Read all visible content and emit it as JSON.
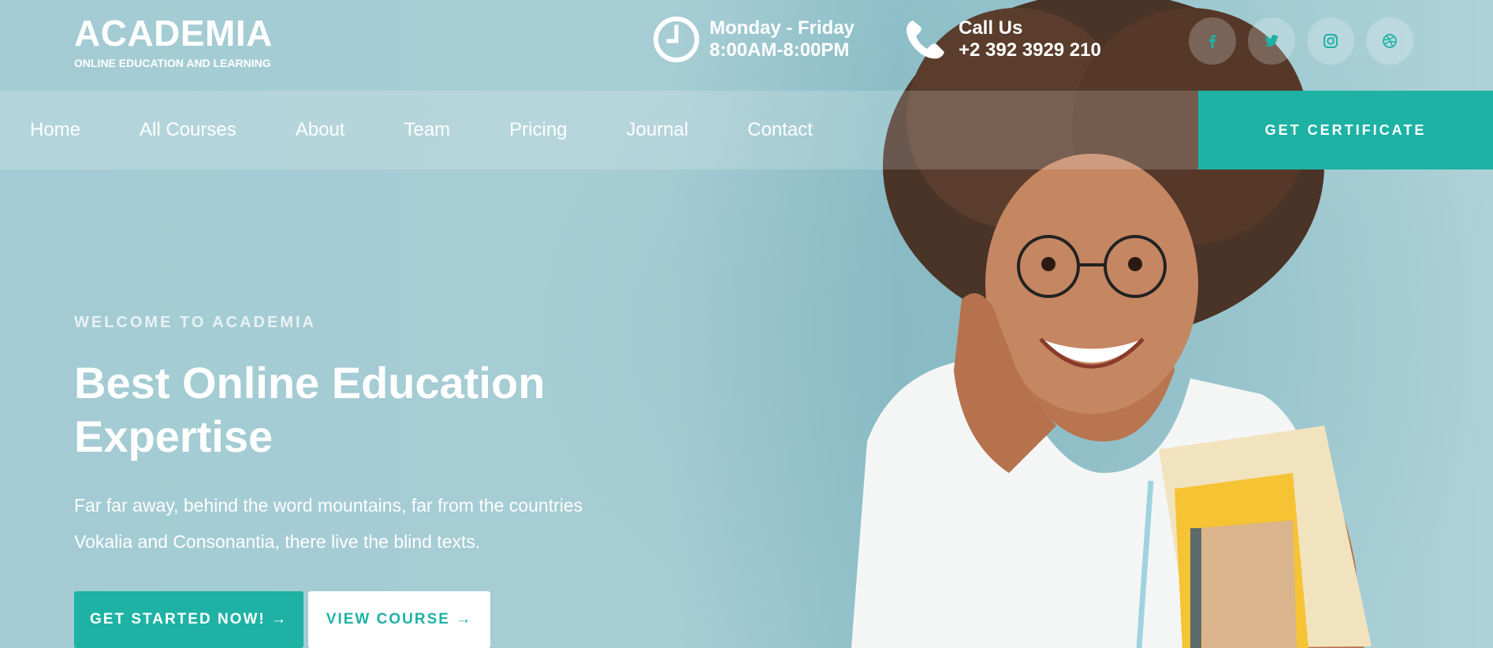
{
  "brand": {
    "name": "ACADEMIA",
    "tagline": "ONLINE EDUCATION AND LEARNING"
  },
  "contact": {
    "hours_title": "Monday - Friday",
    "hours_value": "8:00AM-8:00PM",
    "call_title": "Call Us",
    "call_value": "+2 392 3929 210"
  },
  "socials": [
    {
      "icon": "facebook-icon"
    },
    {
      "icon": "twitter-icon"
    },
    {
      "icon": "instagram-icon"
    },
    {
      "icon": "dribbble-icon"
    }
  ],
  "nav": {
    "items": [
      "Home",
      "All Courses",
      "About",
      "Team",
      "Pricing",
      "Journal",
      "Contact"
    ],
    "cta": "GET CERTIFICATE"
  },
  "hero": {
    "eyebrow": "WELCOME TO ACADEMIA",
    "headline_line1": "Best Online Education",
    "headline_line2": "Expertise",
    "lead_line1": "Far far away, behind the word mountains, far from the countries",
    "lead_line2": "Vokalia and Consonantia, there live the blind texts.",
    "primary_button": "GET STARTED NOW! →",
    "secondary_button": "VIEW COURSE →"
  },
  "colors": {
    "accent": "#1eb2a5",
    "background": "#a6ccd3"
  }
}
